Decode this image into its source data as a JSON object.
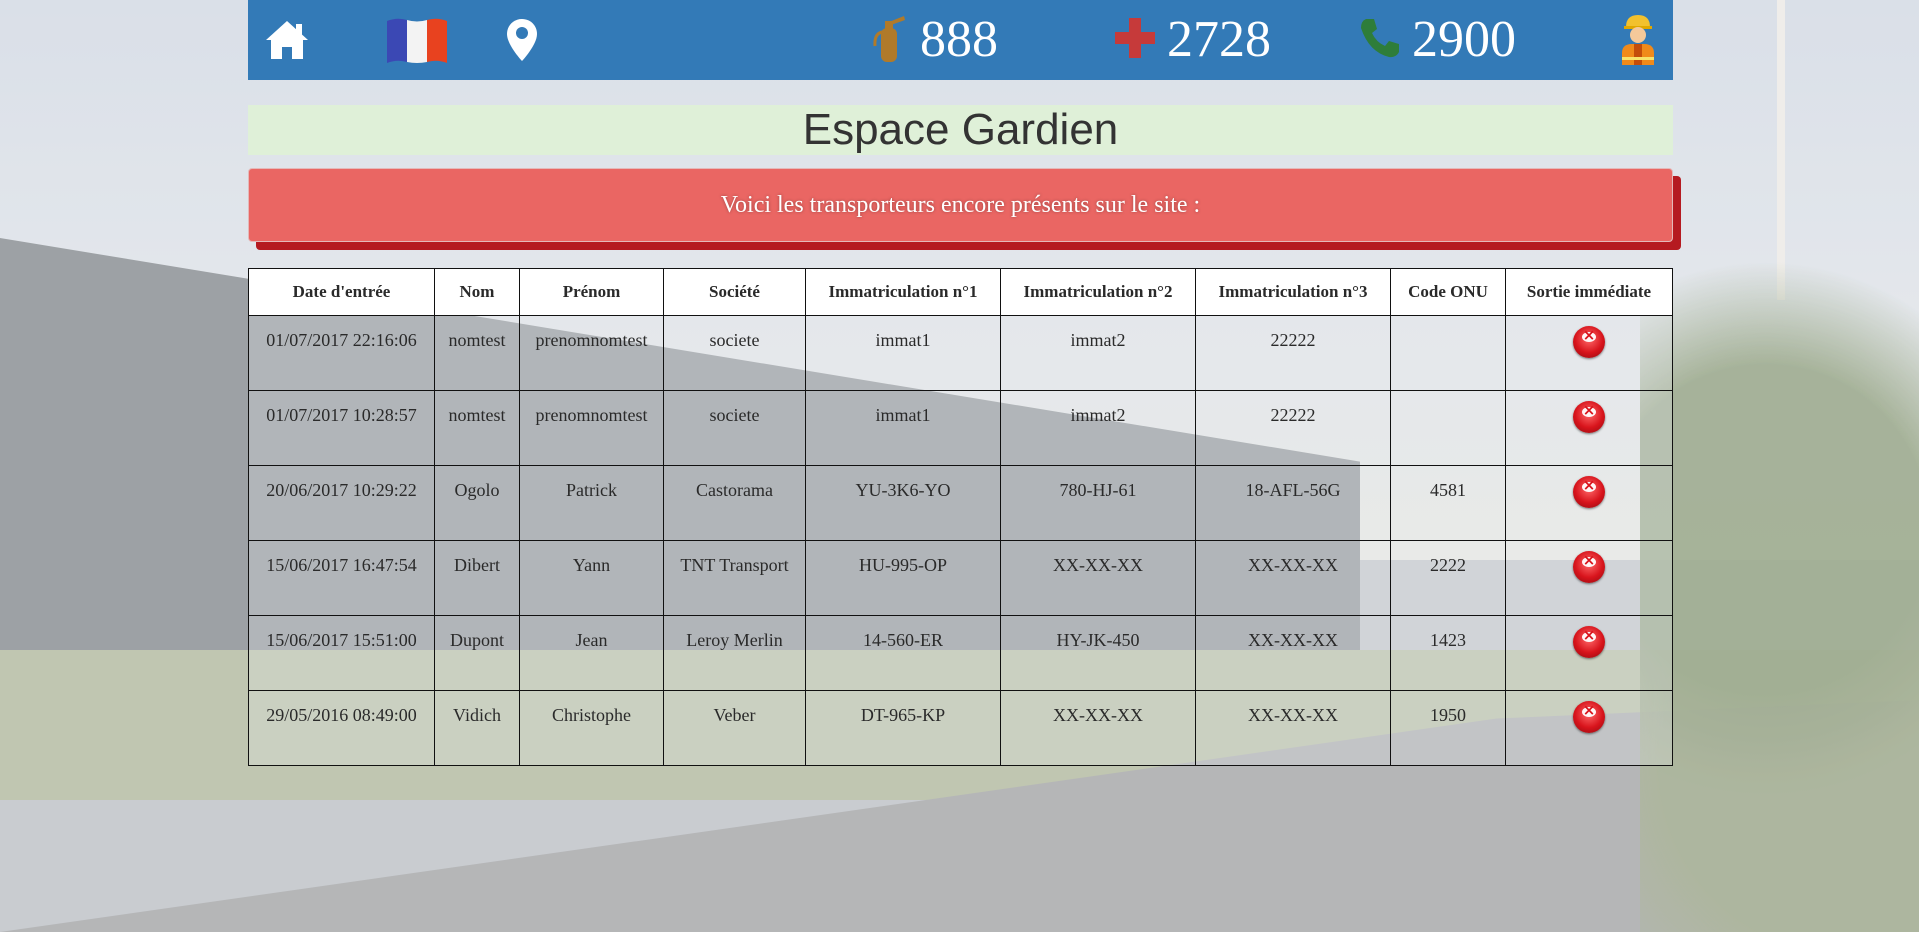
{
  "topbar": {
    "icons": {
      "home": "home-icon",
      "language": "french-flag-icon",
      "location": "map-pin-icon",
      "fire": "fire-extinguisher-icon",
      "medical": "red-cross-icon",
      "phone": "phone-icon",
      "user": "worker-icon"
    },
    "fire_number": "888",
    "medical_number": "2728",
    "phone_number": "2900"
  },
  "colors": {
    "topbar": "#337ab7",
    "title_band": "#dff0d8",
    "alert": "#ea6663",
    "alert_shadow": "#b51a20",
    "delete_button": "#d8141c"
  },
  "page": {
    "title": "Espace Gardien",
    "alert": "Voici les transporteurs encore présents sur le site :"
  },
  "table": {
    "headers": [
      "Date d'entrée",
      "Nom",
      "Prénom",
      "Société",
      "Immatriculation n°1",
      "Immatriculation n°2",
      "Immatriculation n°3",
      "Code ONU",
      "Sortie immédiate"
    ],
    "rows": [
      [
        "01/07/2017 22:16:06",
        "nomtest",
        "prenomnomtest",
        "societe",
        "immat1",
        "immat2",
        "22222",
        ""
      ],
      [
        "01/07/2017 10:28:57",
        "nomtest",
        "prenomnomtest",
        "societe",
        "immat1",
        "immat2",
        "22222",
        ""
      ],
      [
        "20/06/2017 10:29:22",
        "Ogolo",
        "Patrick",
        "Castorama",
        "YU-3K6-YO",
        "780-HJ-61",
        "18-AFL-56G",
        "4581"
      ],
      [
        "15/06/2017 16:47:54",
        "Dibert",
        "Yann",
        "TNT Transport",
        "HU-995-OP",
        "XX-XX-XX",
        "XX-XX-XX",
        "2222"
      ],
      [
        "15/06/2017 15:51:00",
        "Dupont",
        "Jean",
        "Leroy Merlin",
        "14-560-ER",
        "HY-JK-450",
        "XX-XX-XX",
        "1423"
      ],
      [
        "29/05/2016 08:49:00",
        "Vidich",
        "Christophe",
        "Veber",
        "DT-965-KP",
        "XX-XX-XX",
        "XX-XX-XX",
        "1950"
      ]
    ],
    "exit_icon": "delete-circle-icon"
  }
}
